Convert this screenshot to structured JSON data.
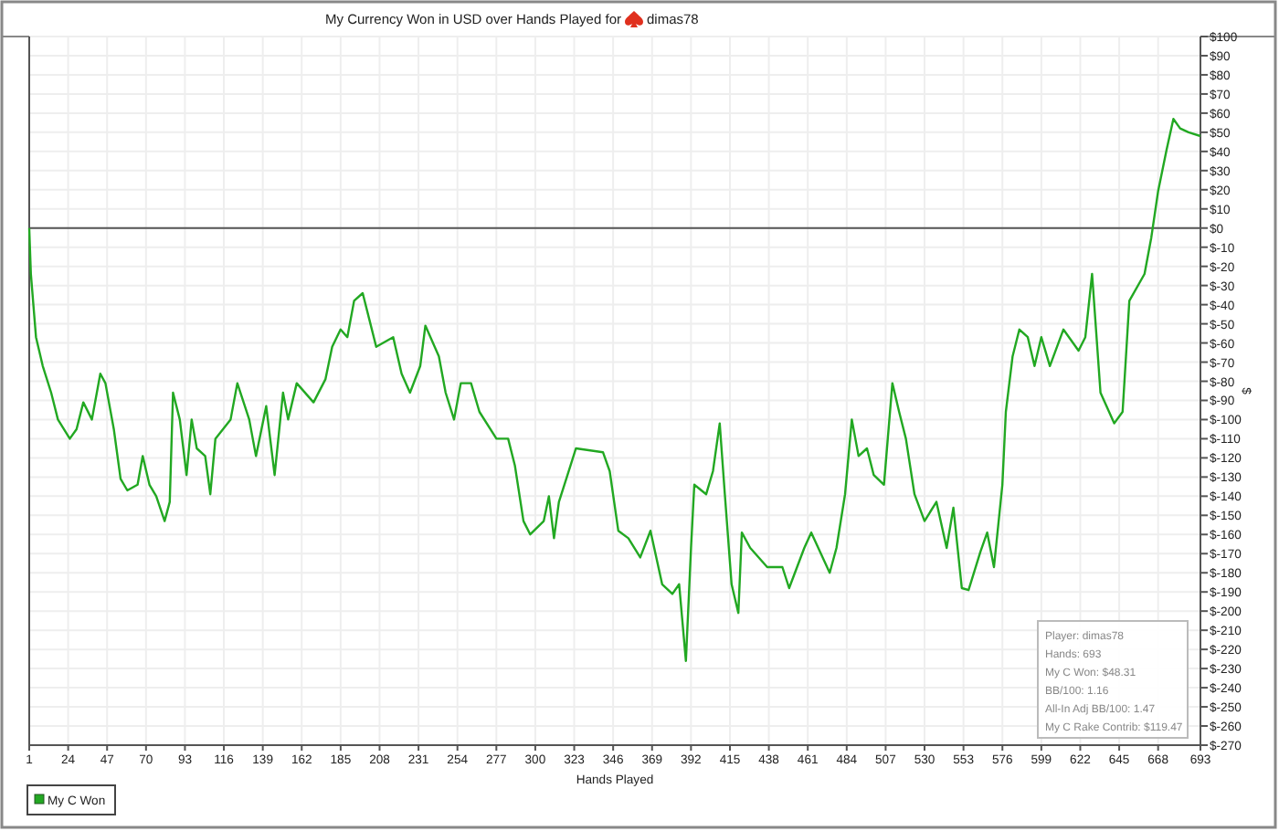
{
  "chart": {
    "player": "dimas78",
    "chart_data": {
      "type": "line",
      "title": "My Currency Won in USD over Hands Played for",
      "grid": true,
      "xlabel": "Hands Played",
      "ylabel": "$",
      "xlim": [
        1,
        693
      ],
      "ylim": [
        -270,
        100
      ],
      "xticks": [
        1,
        24,
        47,
        70,
        93,
        116,
        139,
        162,
        185,
        208,
        231,
        254,
        277,
        300,
        323,
        346,
        369,
        392,
        415,
        438,
        461,
        484,
        507,
        530,
        553,
        576,
        599,
        622,
        645,
        668,
        693
      ],
      "yticks": [
        {
          "value": 100,
          "label": "$100"
        },
        {
          "value": 90,
          "label": "$90"
        },
        {
          "value": 80,
          "label": "$80"
        },
        {
          "value": 70,
          "label": "$70"
        },
        {
          "value": 60,
          "label": "$60"
        },
        {
          "value": 50,
          "label": "$50"
        },
        {
          "value": 40,
          "label": "$40"
        },
        {
          "value": 30,
          "label": "$30"
        },
        {
          "value": 20,
          "label": "$20"
        },
        {
          "value": 10,
          "label": "$10"
        },
        {
          "value": 0,
          "label": "$0"
        },
        {
          "value": -10,
          "label": "$-10"
        },
        {
          "value": -20,
          "label": "$-20"
        },
        {
          "value": -30,
          "label": "$-30"
        },
        {
          "value": -40,
          "label": "$-40"
        },
        {
          "value": -50,
          "label": "$-50"
        },
        {
          "value": -60,
          "label": "$-60"
        },
        {
          "value": -70,
          "label": "$-70"
        },
        {
          "value": -80,
          "label": "$-80"
        },
        {
          "value": -90,
          "label": "$-90"
        },
        {
          "value": -100,
          "label": "$-100"
        },
        {
          "value": -110,
          "label": "$-110"
        },
        {
          "value": -120,
          "label": "$-120"
        },
        {
          "value": -130,
          "label": "$-130"
        },
        {
          "value": -140,
          "label": "$-140"
        },
        {
          "value": -150,
          "label": "$-150"
        },
        {
          "value": -160,
          "label": "$-160"
        },
        {
          "value": -170,
          "label": "$-170"
        },
        {
          "value": -180,
          "label": "$-180"
        },
        {
          "value": -190,
          "label": "$-190"
        },
        {
          "value": -200,
          "label": "$-200"
        },
        {
          "value": -210,
          "label": "$-210"
        },
        {
          "value": -220,
          "label": "$-220"
        },
        {
          "value": -230,
          "label": "$-230"
        },
        {
          "value": -240,
          "label": "$-240"
        },
        {
          "value": -250,
          "label": "$-250"
        },
        {
          "value": -260,
          "label": "$-260"
        },
        {
          "value": -270,
          "label": "$-270"
        }
      ],
      "x": [
        1,
        2,
        5,
        9,
        14,
        18,
        25,
        29,
        33,
        38,
        43,
        46,
        51,
        55,
        59,
        65,
        68,
        72,
        76,
        81,
        84,
        86,
        90,
        94,
        97,
        100,
        105,
        108,
        111,
        120,
        124,
        131,
        135,
        141,
        146,
        151,
        154,
        159,
        169,
        176,
        180,
        185,
        189,
        193,
        198,
        202,
        206,
        216,
        221,
        226,
        232,
        235,
        243,
        247,
        252,
        256,
        262,
        267,
        277,
        284,
        288,
        293,
        297,
        305,
        308,
        311,
        314,
        319,
        324,
        340,
        344,
        349,
        355,
        362,
        368,
        375,
        381,
        385,
        389,
        392,
        394,
        401,
        405,
        409,
        412,
        416,
        420,
        422,
        427,
        437,
        446,
        450,
        459,
        463,
        474,
        478,
        483,
        487,
        491,
        496,
        500,
        506,
        511,
        515,
        519,
        524,
        530,
        537,
        543,
        547,
        552,
        556,
        563,
        567,
        571,
        576,
        578,
        582,
        586,
        591,
        595,
        599,
        604,
        612,
        621,
        625,
        629,
        634,
        642,
        647,
        651,
        660,
        664,
        668,
        673,
        677,
        681,
        686,
        693
      ],
      "series": [
        {
          "name": "My C Won",
          "color": "#22a822",
          "values": [
            0,
            -24,
            -57,
            -72,
            -86,
            -100,
            -110,
            -105,
            -91,
            -100,
            -76,
            -81,
            -105,
            -131,
            -137,
            -134,
            -119,
            -134,
            -140,
            -153,
            -143,
            -86,
            -100,
            -129,
            -100,
            -115,
            -119,
            -139,
            -110,
            -100,
            -81,
            -100,
            -119,
            -93,
            -129,
            -86,
            -100,
            -81,
            -91,
            -79,
            -62,
            -53,
            -57,
            -38,
            -34,
            -48,
            -62,
            -57,
            -76,
            -86,
            -72,
            -51,
            -67,
            -86,
            -100,
            -81,
            -81,
            -96,
            -110,
            -110,
            -124,
            -153,
            -160,
            -153,
            -140,
            -162,
            -143,
            -129,
            -115,
            -117,
            -127,
            -158,
            -162,
            -172,
            -158,
            -186,
            -191,
            -186,
            -226,
            -167,
            -134,
            -139,
            -127,
            -102,
            -139,
            -186,
            -201,
            -159,
            -167,
            -177,
            -177,
            -188,
            -167,
            -159,
            -180,
            -167,
            -139,
            -100,
            -119,
            -115,
            -129,
            -134,
            -81,
            -96,
            -110,
            -139,
            -153,
            -143,
            -167,
            -146,
            -188,
            -189,
            -169,
            -159,
            -177,
            -134,
            -96,
            -67,
            -53,
            -57,
            -72,
            -57,
            -72,
            -53,
            -64,
            -57,
            -24,
            -86,
            -102,
            -96,
            -38,
            -24,
            -5,
            19,
            41,
            57,
            52,
            50,
            48
          ]
        }
      ]
    },
    "info": [
      "Player: dimas78",
      "Hands: 693",
      "My C Won: $48.31",
      "BB/100: 1.16",
      "All-In Adj BB/100: 1.47",
      "My C Rake Contrib: $119.47"
    ]
  }
}
